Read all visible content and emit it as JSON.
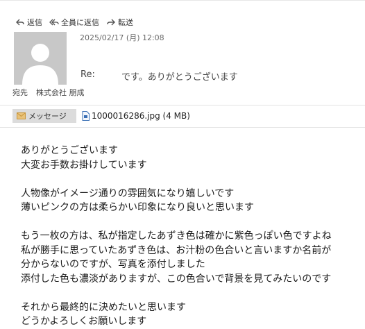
{
  "toolbar": {
    "reply_label": "返信",
    "reply_all_label": "全員に返信",
    "forward_label": "転送"
  },
  "message": {
    "date": "2025/02/17 (月) 12:08",
    "subject_prefix": "Re:",
    "subject": "です。ありがとうございます",
    "to_label": "宛先",
    "to_value": "株式会社 朋成"
  },
  "tabs": {
    "message_label": "メッセージ",
    "attachment_label": "1000016286.jpg (4 MB)"
  },
  "body": {
    "lines": [
      "ありがとうございます",
      "大変お手数お掛けしています",
      "",
      "人物像がイメージ通りの雰囲気になり嬉しいです",
      "薄いピンクの方は柔らかい印象になり良いと思います",
      "",
      "もう一枚の方は、私が指定したあずき色は確かに紫色っぽい色ですよね",
      "私が勝手に思っていたあずき色は、お汁粉の色合いと言いますか名前が",
      "分からないのですが、写真を添付しました",
      "添付した色も濃淡がありますが、この色合いで背景を見てみたいのです",
      "",
      "それから最終的に決めたいと思います",
      "どうかよろしくお願いします"
    ]
  },
  "icons": {
    "reply": "reply-icon",
    "reply_all": "reply-all-icon",
    "forward": "forward-icon",
    "envelope": "envelope-icon",
    "file": "file-icon",
    "avatar": "person-silhouette"
  },
  "colors": {
    "avatar_bg": "#c8c8c8",
    "tab_bg": "#dcdcdc",
    "envelope": "#e0b15a",
    "file_icon": "#3a6fb5"
  }
}
